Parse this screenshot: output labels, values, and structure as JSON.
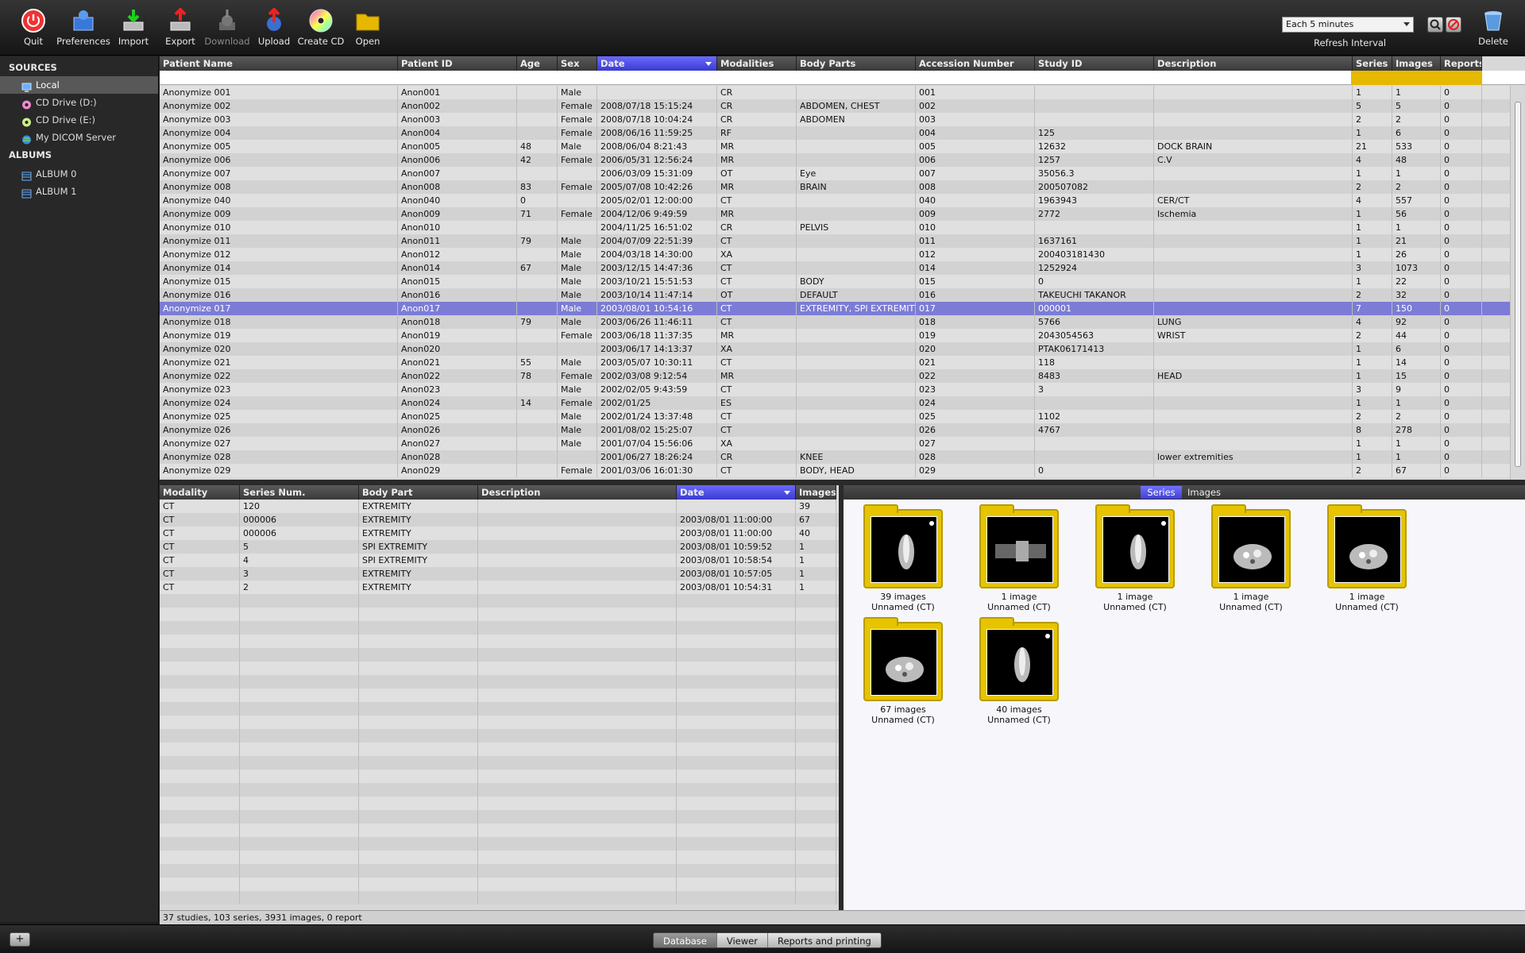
{
  "toolbar": {
    "quit": "Quit",
    "preferences": "Preferences",
    "import": "Import",
    "export": "Export",
    "download": "Download",
    "upload": "Upload",
    "create_cd": "Create CD",
    "open": "Open",
    "refresh_value": "Each 5 minutes",
    "refresh_label": "Refresh Interval",
    "delete": "Delete"
  },
  "sidebar": {
    "sources_title": "SOURCES",
    "sources": [
      "Local",
      "CD Drive (D:)",
      "CD Drive (E:)",
      "My DICOM Server"
    ],
    "albums_title": "ALBUMS",
    "albums": [
      "ALBUM 0",
      "ALBUM 1"
    ]
  },
  "studies": {
    "columns": [
      "Patient Name",
      "Patient ID",
      "Age",
      "Sex",
      "Date",
      "Modalities",
      "Body Parts",
      "Accession Number",
      "Study ID",
      "Description",
      "Series",
      "Images",
      "Reports"
    ],
    "rows": [
      [
        "Anonymize 001",
        "Anon001",
        "",
        "Male",
        "",
        "CR",
        "",
        "001",
        "",
        "",
        "1",
        "1",
        "0"
      ],
      [
        "Anonymize 002",
        "Anon002",
        "",
        "Female",
        "2008/07/18 15:15:24",
        "CR",
        "ABDOMEN, CHEST",
        "002",
        "",
        "",
        "5",
        "5",
        "0"
      ],
      [
        "Anonymize 003",
        "Anon003",
        "",
        "Female",
        "2008/07/18 10:04:24",
        "CR",
        "ABDOMEN",
        "003",
        "",
        "",
        "2",
        "2",
        "0"
      ],
      [
        "Anonymize 004",
        "Anon004",
        "",
        "Female",
        "2008/06/16 11:59:25",
        "RF",
        "",
        "004",
        "125",
        "",
        "1",
        "6",
        "0"
      ],
      [
        "Anonymize 005",
        "Anon005",
        "48",
        "Male",
        "2008/06/04 8:21:43",
        "MR",
        "",
        "005",
        "12632",
        "DOCK BRAIN",
        "21",
        "533",
        "0"
      ],
      [
        "Anonymize 006",
        "Anon006",
        "42",
        "Female",
        "2006/05/31 12:56:24",
        "MR",
        "",
        "006",
        "1257",
        "C.V",
        "4",
        "48",
        "0"
      ],
      [
        "Anonymize 007",
        "Anon007",
        "",
        "",
        "2006/03/09 15:31:09",
        "OT",
        "Eye",
        "007",
        "35056.3",
        "",
        "1",
        "1",
        "0"
      ],
      [
        "Anonymize 008",
        "Anon008",
        "83",
        "Female",
        "2005/07/08 10:42:26",
        "MR",
        "BRAIN",
        "008",
        "200507082",
        "",
        "2",
        "2",
        "0"
      ],
      [
        "Anonymize 040",
        "Anon040",
        "0",
        "",
        "2005/02/01 12:00:00",
        "CT",
        "",
        "040",
        "1963943",
        "CER/CT",
        "4",
        "557",
        "0"
      ],
      [
        "Anonymize 009",
        "Anon009",
        "71",
        "Female",
        "2004/12/06 9:49:59",
        "MR",
        "",
        "009",
        "2772",
        "Ischemia",
        "1",
        "56",
        "0"
      ],
      [
        "Anonymize 010",
        "Anon010",
        "",
        "",
        "2004/11/25 16:51:02",
        "CR",
        "PELVIS",
        "010",
        "",
        "",
        "1",
        "1",
        "0"
      ],
      [
        "Anonymize 011",
        "Anon011",
        "79",
        "Male",
        "2004/07/09 22:51:39",
        "CT",
        "",
        "011",
        "1637161",
        "",
        "1",
        "21",
        "0"
      ],
      [
        "Anonymize 012",
        "Anon012",
        "",
        "Male",
        "2004/03/18 14:30:00",
        "XA",
        "",
        "012",
        "200403181430",
        "",
        "1",
        "26",
        "0"
      ],
      [
        "Anonymize 014",
        "Anon014",
        "67",
        "Male",
        "2003/12/15 14:47:36",
        "CT",
        "",
        "014",
        "1252924",
        "",
        "3",
        "1073",
        "0"
      ],
      [
        "Anonymize 015",
        "Anon015",
        "",
        "Male",
        "2003/10/21 15:51:53",
        "CT",
        "BODY",
        "015",
        "0",
        "",
        "1",
        "22",
        "0"
      ],
      [
        "Anonymize 016",
        "Anon016",
        "",
        "Male",
        "2003/10/14 11:47:14",
        "OT",
        "DEFAULT",
        "016",
        "TAKEUCHI TAKANOR",
        "",
        "2",
        "32",
        "0"
      ],
      [
        "Anonymize 017",
        "Anon017",
        "",
        "Male",
        "2003/08/01 10:54:16",
        "CT",
        "EXTREMITY, SPI EXTREMITY",
        "017",
        "000001",
        "",
        "7",
        "150",
        "0"
      ],
      [
        "Anonymize 018",
        "Anon018",
        "79",
        "Male",
        "2003/06/26 11:46:11",
        "CT",
        "",
        "018",
        "5766",
        "LUNG",
        "4",
        "92",
        "0"
      ],
      [
        "Anonymize 019",
        "Anon019",
        "",
        "Female",
        "2003/06/18 11:37:35",
        "MR",
        "",
        "019",
        "2043054563",
        "WRIST",
        "2",
        "44",
        "0"
      ],
      [
        "Anonymize 020",
        "Anon020",
        "",
        "",
        "2003/06/17 14:13:37",
        "XA",
        "",
        "020",
        "PTAK06171413",
        "",
        "1",
        "6",
        "0"
      ],
      [
        "Anonymize 021",
        "Anon021",
        "55",
        "Male",
        "2003/05/07 10:30:11",
        "CT",
        "",
        "021",
        "118",
        "",
        "1",
        "14",
        "0"
      ],
      [
        "Anonymize 022",
        "Anon022",
        "78",
        "Female",
        "2002/03/08 9:12:54",
        "MR",
        "",
        "022",
        "8483",
        "HEAD",
        "1",
        "15",
        "0"
      ],
      [
        "Anonymize 023",
        "Anon023",
        "",
        "Male",
        "2002/02/05 9:43:59",
        "CT",
        "",
        "023",
        "3",
        "",
        "3",
        "9",
        "0"
      ],
      [
        "Anonymize 024",
        "Anon024",
        "14",
        "Female",
        "2002/01/25",
        "ES",
        "",
        "024",
        "",
        "",
        "1",
        "1",
        "0"
      ],
      [
        "Anonymize 025",
        "Anon025",
        "",
        "Male",
        "2002/01/24 13:37:48",
        "CT",
        "",
        "025",
        "1102",
        "",
        "2",
        "2",
        "0"
      ],
      [
        "Anonymize 026",
        "Anon026",
        "",
        "Male",
        "2001/08/02 15:25:07",
        "CT",
        "",
        "026",
        "4767",
        "",
        "8",
        "278",
        "0"
      ],
      [
        "Anonymize 027",
        "Anon027",
        "",
        "Male",
        "2001/07/04 15:56:06",
        "XA",
        "",
        "027",
        "",
        "",
        "1",
        "1",
        "0"
      ],
      [
        "Anonymize 028",
        "Anon028",
        "",
        "",
        "2001/06/27 18:26:24",
        "CR",
        "KNEE",
        "028",
        "",
        "lower extremities",
        "1",
        "1",
        "0"
      ],
      [
        "Anonymize 029",
        "Anon029",
        "",
        "Female",
        "2001/03/06 16:01:30",
        "CT",
        "BODY, HEAD",
        "029",
        "0",
        "",
        "2",
        "67",
        "0"
      ]
    ]
  },
  "series": {
    "columns": [
      "Modality",
      "Series Num.",
      "Body Part",
      "Description",
      "Date",
      "Images"
    ],
    "rows": [
      [
        "CT",
        "120",
        "EXTREMITY",
        "",
        "",
        "39"
      ],
      [
        "CT",
        "000006",
        "EXTREMITY",
        "",
        "2003/08/01 11:00:00",
        "67"
      ],
      [
        "CT",
        "000006",
        "EXTREMITY",
        "",
        "2003/08/01 11:00:00",
        "40"
      ],
      [
        "CT",
        "5",
        "SPI EXTREMITY",
        "",
        "2003/08/01 10:59:52",
        "1"
      ],
      [
        "CT",
        "4",
        "SPI EXTREMITY",
        "",
        "2003/08/01 10:58:54",
        "1"
      ],
      [
        "CT",
        "3",
        "EXTREMITY",
        "",
        "2003/08/01 10:57:05",
        "1"
      ],
      [
        "CT",
        "2",
        "EXTREMITY",
        "",
        "2003/08/01 10:54:31",
        "1"
      ]
    ]
  },
  "thumbs": {
    "tab_series": "Series",
    "tab_images": "Images",
    "items": [
      {
        "count": "39 images",
        "name": "Unnamed (CT)"
      },
      {
        "count": "1 image",
        "name": "Unnamed (CT)"
      },
      {
        "count": "1 image",
        "name": "Unnamed (CT)"
      },
      {
        "count": "1 image",
        "name": "Unnamed (CT)"
      },
      {
        "count": "1 image",
        "name": "Unnamed (CT)"
      },
      {
        "count": "67 images",
        "name": "Unnamed (CT)"
      },
      {
        "count": "40 images",
        "name": "Unnamed (CT)"
      }
    ]
  },
  "status": "37 studies, 103 series, 3931 images, 0 report",
  "bottom": {
    "plus": "+",
    "tabs": [
      "Database",
      "Viewer",
      "Reports and printing"
    ]
  }
}
